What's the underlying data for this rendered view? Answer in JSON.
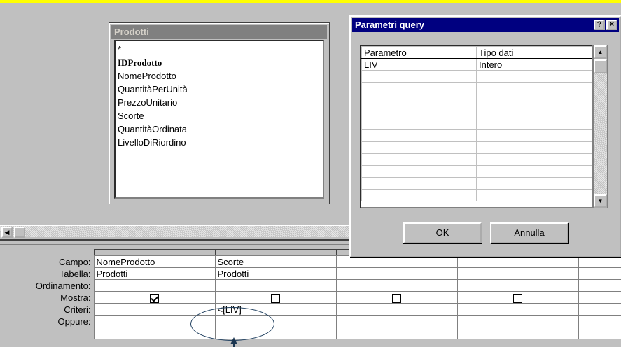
{
  "table_box": {
    "title": "Prodotti",
    "fields": [
      "*",
      "IDProdotto",
      "NomeProdotto",
      "QuantitàPerUnità",
      "PrezzoUnitario",
      "Scorte",
      "QuantitàOrdinata",
      "LivelloDiRiordino"
    ]
  },
  "grid": {
    "row_labels": [
      "Campo:",
      "Tabella:",
      "Ordinamento:",
      "Mostra:",
      "Criteri:",
      "Oppure:"
    ],
    "col1": {
      "campo": "NomeProdotto",
      "tabella": "Prodotti",
      "mostra": true
    },
    "col2": {
      "campo": "Scorte",
      "tabella": "Prodotti",
      "mostra": false,
      "criteri": "<[LIV]"
    },
    "col3": {
      "mostra": false
    },
    "col4": {
      "mostra": false
    }
  },
  "dialog": {
    "title": "Parametri query",
    "help_button": "?",
    "close_button": "×",
    "col_headers": [
      "Parametro",
      "Tipo dati"
    ],
    "rows": [
      {
        "parametro": "LIV",
        "tipo": "Intero"
      }
    ],
    "ok_label": "OK",
    "cancel_label": "Annulla"
  },
  "icons": {
    "scroll_left": "arrow-left-icon",
    "scroll_up": "arrow-up-icon",
    "scroll_down": "arrow-down-icon"
  },
  "colors": {
    "highlight_background": "#ffff00",
    "dialog_titlebar": "#000080",
    "inactive_titlebar": "#808080",
    "annotation": "#1a3550"
  }
}
